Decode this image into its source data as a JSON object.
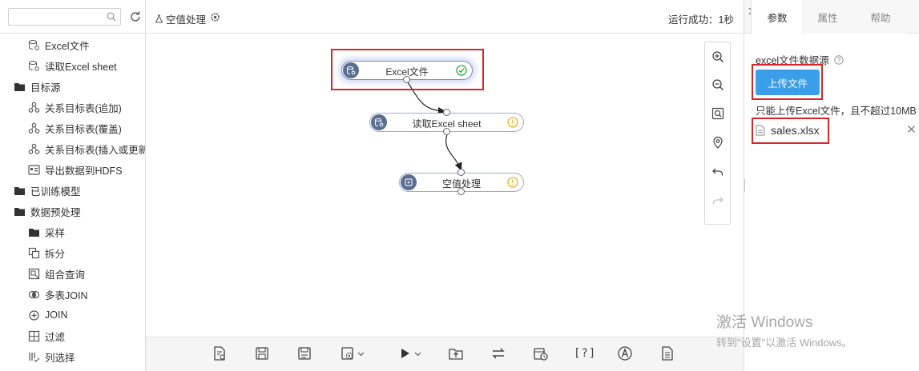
{
  "sidebar": {
    "search_placeholder": "",
    "items": [
      {
        "label": "Excel文件",
        "icon": "excel-db-icon",
        "level": 1
      },
      {
        "label": "读取Excel sheet",
        "icon": "excel-db-icon",
        "level": 1
      },
      {
        "label": "目标源",
        "icon": "folder-icon",
        "level": 0
      },
      {
        "label": "关系目标表(追加)",
        "icon": "relation-icon",
        "level": 1
      },
      {
        "label": "关系目标表(覆盖)",
        "icon": "relation-icon",
        "level": 1
      },
      {
        "label": "关系目标表(插入或更新)",
        "icon": "relation-icon",
        "level": 1
      },
      {
        "label": "导出数据到HDFS",
        "icon": "hdfs-icon",
        "level": 1
      },
      {
        "label": "已训练模型",
        "icon": "folder-icon",
        "level": 0
      },
      {
        "label": "数据预处理",
        "icon": "folder-icon",
        "level": 0
      },
      {
        "label": "采样",
        "icon": "folder-icon",
        "level": 1
      },
      {
        "label": "拆分",
        "icon": "split-icon",
        "level": 1
      },
      {
        "label": "组合查询",
        "icon": "combine-icon",
        "level": 1
      },
      {
        "label": "多表JOIN",
        "icon": "multi-join-icon",
        "level": 1
      },
      {
        "label": "JOIN",
        "icon": "join-icon",
        "level": 1
      },
      {
        "label": "过滤",
        "icon": "filter-icon",
        "level": 1
      },
      {
        "label": "列选择",
        "icon": "column-select-icon",
        "level": 1
      }
    ]
  },
  "header": {
    "title": "空值处理",
    "status": "运行成功：1秒"
  },
  "nodes": {
    "excel": {
      "label": "Excel文件",
      "status": "success"
    },
    "read_sheet": {
      "label": "读取Excel sheet",
      "status": "warning"
    },
    "null_handle": {
      "label": "空值处理",
      "status": "warning"
    }
  },
  "right_panel": {
    "tabs": [
      "参数",
      "属性",
      "帮助"
    ],
    "active_tab": "参数",
    "source_label": "excel文件数据源",
    "upload_label": "上传文件",
    "upload_hint": "只能上传Excel文件，且不超过10MB",
    "file_name": "sales.xlsx"
  },
  "bottom_toolbar": {
    "help_text": "[?]"
  },
  "watermark": {
    "line1": "激活 Windows",
    "line2": "转到\"设置\"以激活 Windows。"
  },
  "colors": {
    "accent": "#3a9ee8",
    "highlight": "#d9252a",
    "node_icon_bg": "#5c6e91",
    "success": "#2eaa3f",
    "warning": "#e8b52a"
  }
}
